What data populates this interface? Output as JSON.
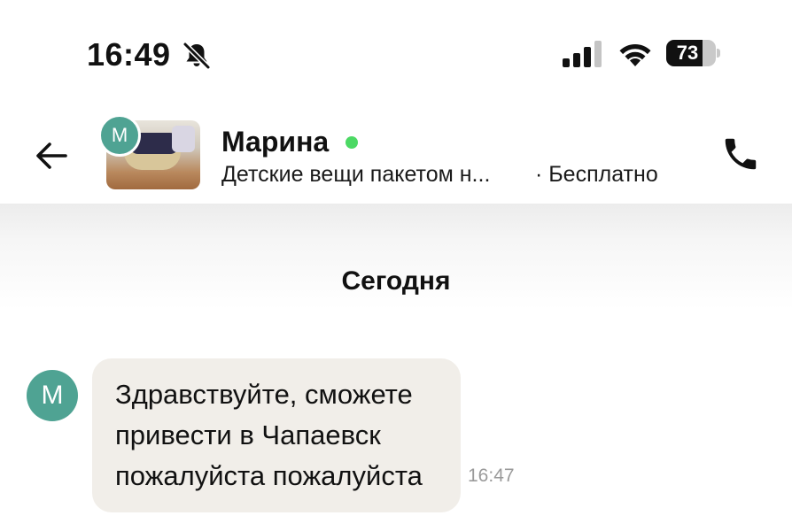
{
  "status_bar": {
    "time": "16:49",
    "battery_level": "73",
    "battery_fraction": 0.73,
    "icons": [
      "bell-slash-icon",
      "signal-icon",
      "wifi-icon",
      "battery-icon"
    ]
  },
  "header": {
    "back_icon": "arrow-left-icon",
    "seller_initial": "М",
    "seller_name": "Марина",
    "online": true,
    "ad_title": "Детские вещи пакетом н...",
    "ad_price": "· Бесплатно",
    "call_icon": "phone-icon"
  },
  "chat": {
    "date_divider": "Сегодня",
    "messages": [
      {
        "sender_initial": "М",
        "text": "Здравствуйте,  сможете\nпривести в Чапаевск\nпожалуйста пожалуйста",
        "time": "16:47"
      }
    ]
  },
  "colors": {
    "avatar": "#4fa393",
    "online": "#4cd964",
    "bubble": "#f1eee9"
  }
}
